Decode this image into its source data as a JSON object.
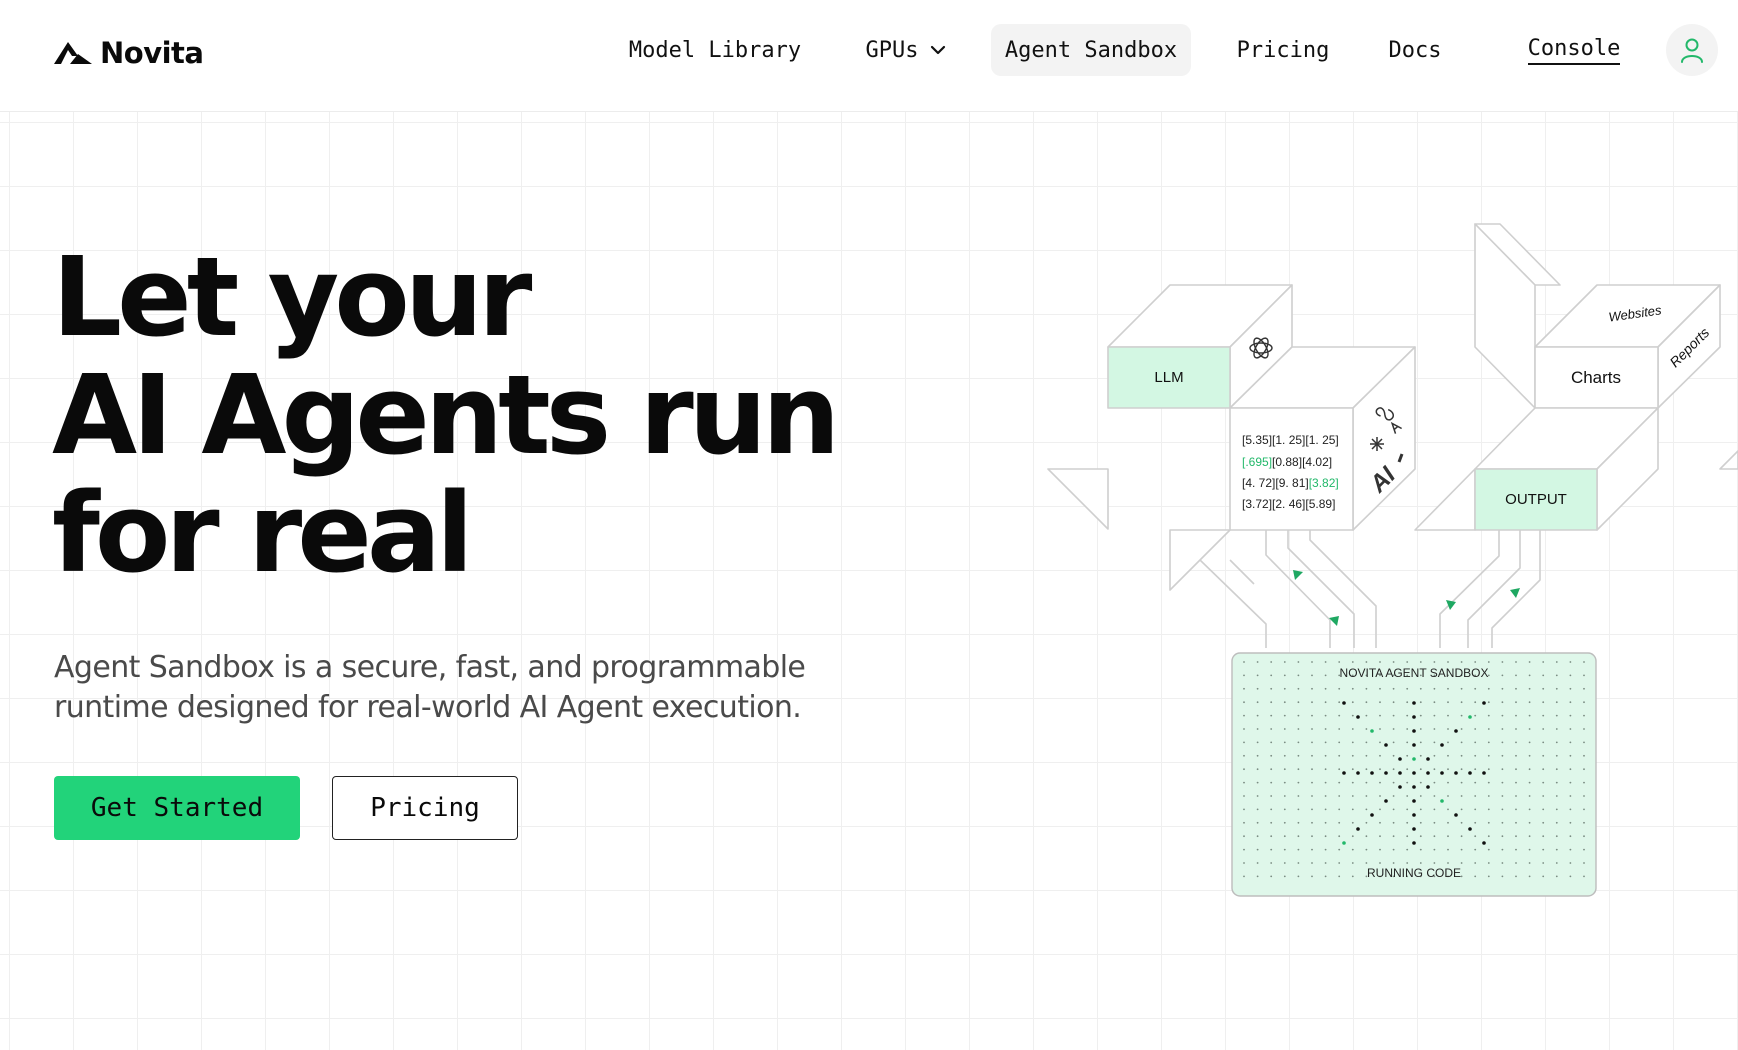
{
  "brand": {
    "name": "Novita",
    "logo_icon": "novita-logo-icon"
  },
  "nav": {
    "model_library": "Model Library",
    "gpus": "GPUs",
    "agent_sandbox": "Agent Sandbox",
    "pricing": "Pricing",
    "docs": "Docs",
    "console": "Console",
    "active": "Agent Sandbox",
    "gpus_icon": "chevron-down-icon",
    "account_icon": "user-icon"
  },
  "hero": {
    "title_line1": "Let your",
    "title_line2": "AI Agents run",
    "title_line3": "for real",
    "subtitle": "Agent Sandbox is a secure, fast, and programmable runtime designed for real-world AI Agent execution.",
    "primary_button": "Get Started",
    "secondary_button": "Pricing"
  },
  "illustration": {
    "llm_label": "LLM",
    "llm_icon": "openai-icon",
    "model_icons": [
      "meta-icon",
      "claude-icon",
      "anthropic-icon",
      "mistral-icon"
    ],
    "ai_mark": "AI",
    "matrix_rows": [
      [
        "[5.35]",
        "[1. 25]",
        "[1. 25]"
      ],
      [
        "[.695]",
        "[0.88]",
        "[4.02]"
      ],
      [
        "[4. 72]",
        "[9. 81]",
        "[3.82]"
      ],
      [
        "[3.72]",
        "[2. 46]",
        "[5.89]"
      ]
    ],
    "charts_label": "Charts",
    "websites_label": "Websites",
    "reports_label": "Reports",
    "output_label": "OUTPUT",
    "sandbox_title": "NOVITA AGENT SANDBOX",
    "sandbox_footer": "RUNNING CODE",
    "colors": {
      "accent": "#22d37a",
      "mint_fill": "#d3f7e3",
      "sandbox_fill": "#dff7ea",
      "line": "#cfcfcf",
      "arrow": "#1fa862"
    }
  }
}
